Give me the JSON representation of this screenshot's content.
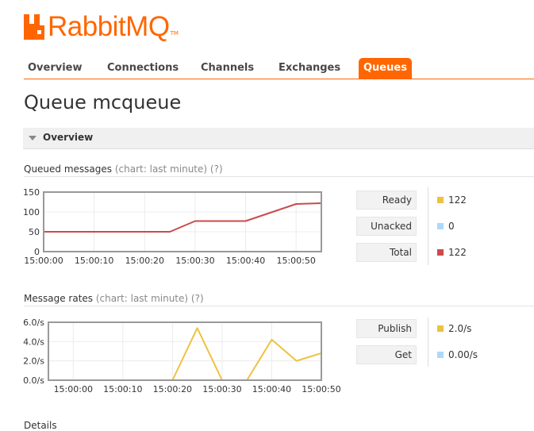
{
  "logo": {
    "text": "RabbitMQ",
    "tm": "TM",
    "color": "#ff6600"
  },
  "nav": {
    "tabs": [
      {
        "label": "Overview",
        "active": false
      },
      {
        "label": "Connections",
        "active": false
      },
      {
        "label": "Channels",
        "active": false
      },
      {
        "label": "Exchanges",
        "active": false
      },
      {
        "label": "Queues",
        "active": true
      }
    ]
  },
  "page": {
    "title": "Queue mcqueue"
  },
  "overview_section": {
    "label": "Overview"
  },
  "queued_messages": {
    "title": "Queued messages",
    "hint": "(chart: last minute) (?)",
    "legend": [
      {
        "label": "Ready",
        "value": "122",
        "color": "#edc240"
      },
      {
        "label": "Unacked",
        "value": "0",
        "color": "#afd8f8"
      },
      {
        "label": "Total",
        "value": "122",
        "color": "#cb4b4b"
      }
    ]
  },
  "message_rates": {
    "title": "Message rates",
    "hint": "(chart: last minute) (?)",
    "legend": [
      {
        "label": "Publish",
        "value": "2.0/s",
        "color": "#edc240"
      },
      {
        "label": "Get",
        "value": "0.00/s",
        "color": "#afd8f8"
      }
    ]
  },
  "details": {
    "label": "Details"
  },
  "chart_data": [
    {
      "type": "line",
      "x_ticks": [
        "15:00:00",
        "15:00:10",
        "15:00:20",
        "15:00:30",
        "15:00:40",
        "15:00:50"
      ],
      "y_ticks": [
        "0",
        "50",
        "100",
        "150"
      ],
      "ylim": [
        0,
        150
      ],
      "xlim": [
        0,
        55
      ],
      "grid": true,
      "series": [
        {
          "name": "Ready",
          "color": "#edc240",
          "x": [
            0,
            55
          ],
          "y": [
            0,
            0
          ]
        },
        {
          "name": "Unacked",
          "color": "#afd8f8",
          "x": [
            0,
            55
          ],
          "y": [
            0,
            0
          ]
        },
        {
          "name": "Total",
          "color": "#cb4b4b",
          "x": [
            0,
            25,
            30,
            40,
            50,
            55
          ],
          "y": [
            50,
            50,
            77,
            77,
            120,
            122
          ]
        }
      ]
    },
    {
      "type": "line",
      "x_ticks": [
        "15:00:00",
        "15:00:10",
        "15:00:20",
        "15:00:30",
        "15:00:40",
        "15:00:50"
      ],
      "y_ticks": [
        "0.0/s",
        "2.0/s",
        "4.0/s",
        "6.0/s"
      ],
      "ylim": [
        0,
        6
      ],
      "xlim": [
        -5,
        50
      ],
      "grid": true,
      "series": [
        {
          "name": "Publish",
          "color": "#edc240",
          "x": [
            -5,
            20,
            25,
            30,
            35,
            40,
            45,
            50
          ],
          "y": [
            0,
            0,
            5.4,
            0,
            0,
            4.2,
            2.0,
            2.8
          ]
        },
        {
          "name": "Get",
          "color": "#afd8f8",
          "x": [
            -5,
            50
          ],
          "y": [
            0,
            0
          ]
        }
      ]
    }
  ]
}
